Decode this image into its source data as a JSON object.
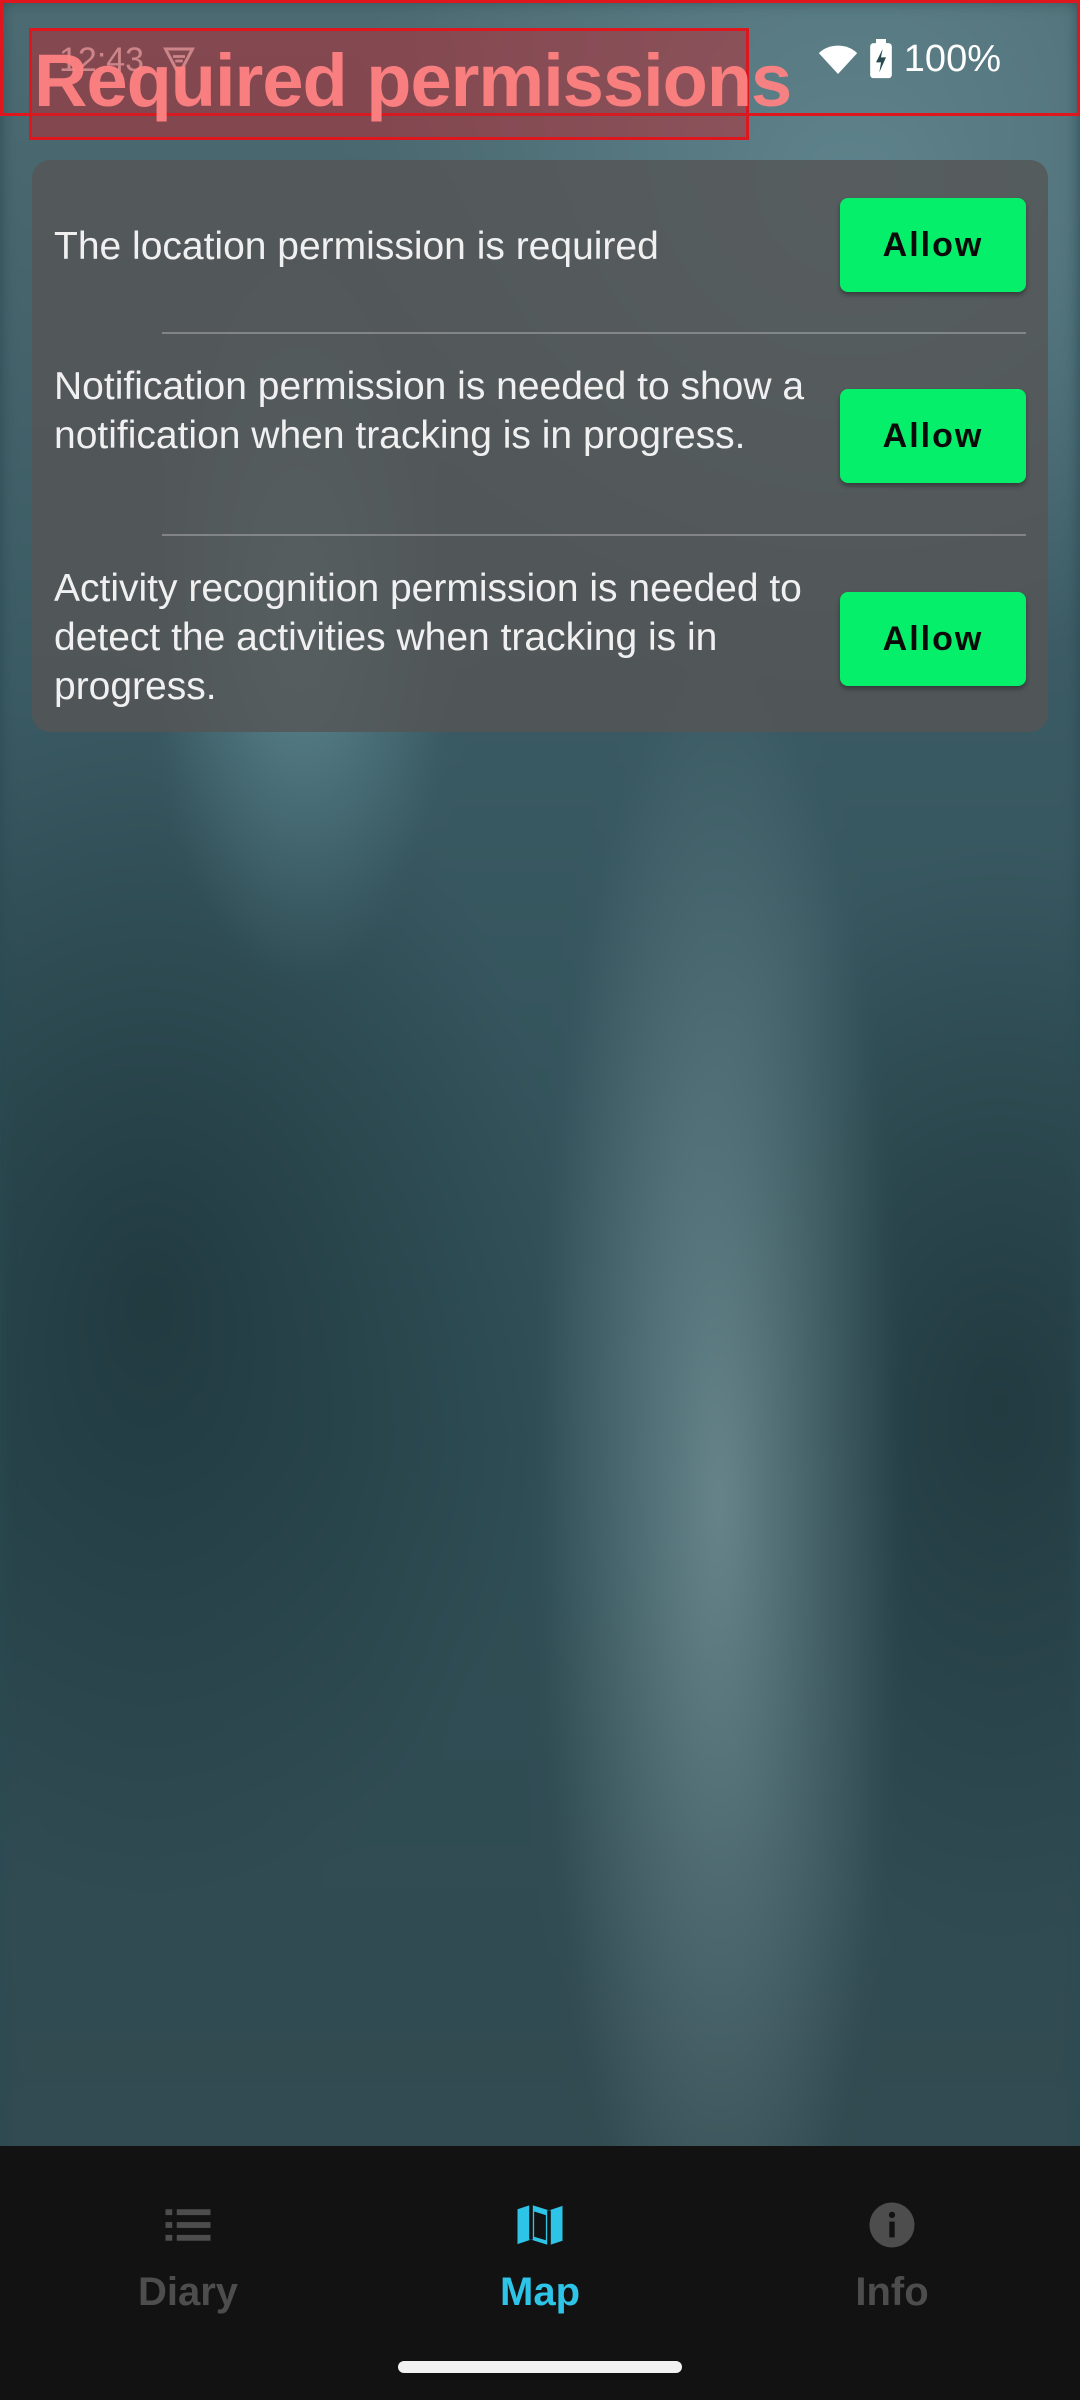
{
  "status_bar": {
    "time": "12:43",
    "battery": "100%",
    "icons": [
      "app-notification-icon",
      "wifi-icon",
      "battery-charging-icon"
    ]
  },
  "page": {
    "title": "Required permissions"
  },
  "permissions": [
    {
      "text": "The location permission is required",
      "button": "Allow"
    },
    {
      "text": "Notification permission is needed to show a notification when tracking is in progress.",
      "button": "Allow"
    },
    {
      "text": "Activity recognition permission is needed to detect the activities when tracking is in progress.",
      "button": "Allow"
    }
  ],
  "bottom_nav": {
    "items": [
      {
        "label": "Diary",
        "icon": "list-icon",
        "active": false
      },
      {
        "label": "Map",
        "icon": "map-icon",
        "active": true
      },
      {
        "label": "Info",
        "icon": "info-icon",
        "active": false
      }
    ]
  },
  "colors": {
    "allow_button": "#05ef6a",
    "nav_active": "#2ec4e8",
    "nav_inactive": "#4d4d4d",
    "highlight_box": "#e0161e"
  }
}
